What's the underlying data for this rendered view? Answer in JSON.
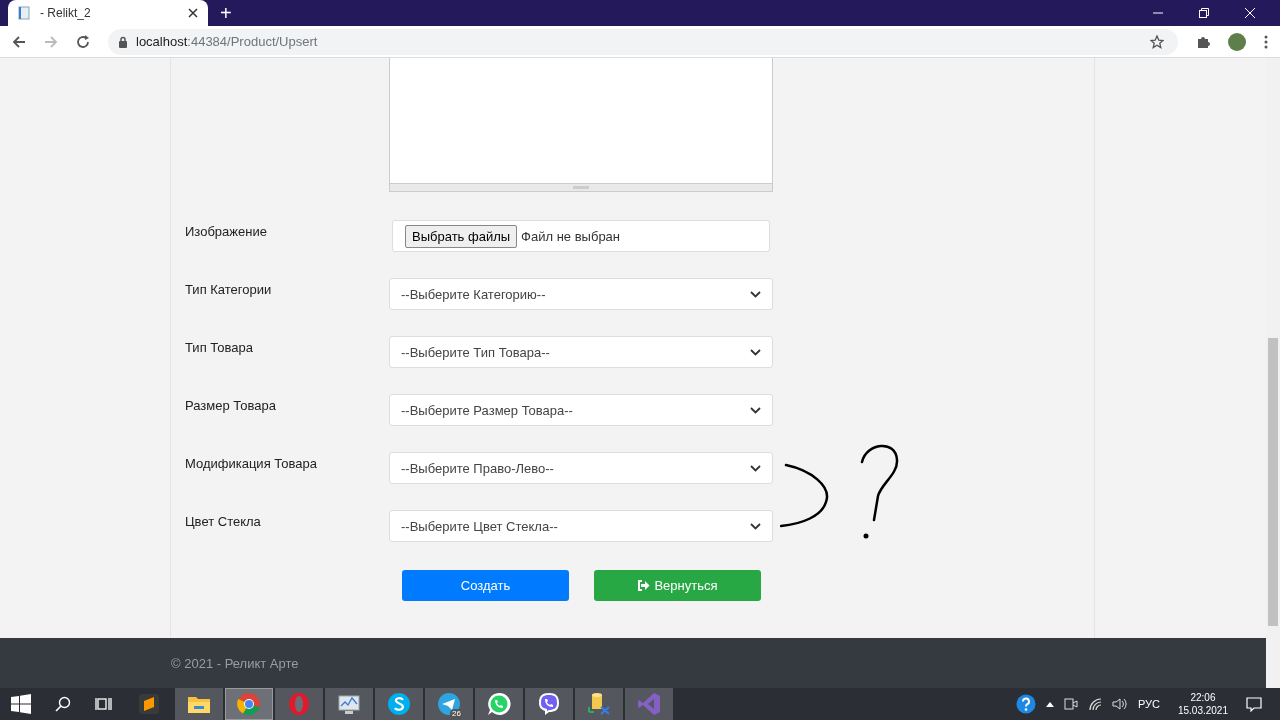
{
  "browser": {
    "tab": {
      "title": "- Relikt_2",
      "selected": true
    },
    "new_tab": "+",
    "url": {
      "host": "localhost",
      "path": ":44384/Product/Upsert"
    },
    "forward_disabled": true
  },
  "form": {
    "fields": [
      {
        "kind": "file",
        "label": "Изображение",
        "button": "Выбрать файлы",
        "status": "Файл не выбран"
      },
      {
        "kind": "select",
        "label": "Тип Категории",
        "value": "--Выберите Категорию--"
      },
      {
        "kind": "select",
        "label": "Тип Товара",
        "value": "--Выберите Тип Товара--"
      },
      {
        "kind": "select",
        "label": "Размер Товара",
        "value": "--Выберите Размер Товара--"
      },
      {
        "kind": "select",
        "label": "Модификация Товара",
        "value": "--Выберите Право-Лево--"
      },
      {
        "kind": "select",
        "label": "Цвет Стекла",
        "value": "--Выберите Цвет Стекла--"
      }
    ],
    "buttons": [
      {
        "kind": "primary",
        "label": "Создать"
      },
      {
        "kind": "back",
        "label": "Вернуться"
      }
    ]
  },
  "footer": {
    "text": "© 2021 - Реликт Арте"
  },
  "taskbar": {
    "apps": [
      {
        "kind": "sublime",
        "open": false,
        "selected": false
      },
      {
        "kind": "explorer",
        "open": true,
        "selected": false
      },
      {
        "kind": "chrome",
        "open": true,
        "selected": true
      },
      {
        "kind": "opera",
        "open": true,
        "selected": false
      },
      {
        "kind": "monitor",
        "open": true,
        "selected": false
      },
      {
        "kind": "skype",
        "open": true,
        "selected": false
      },
      {
        "kind": "telegram",
        "open": true,
        "selected": false,
        "badge": "26"
      },
      {
        "kind": "whatsapp",
        "open": true,
        "selected": false
      },
      {
        "kind": "viber",
        "open": true,
        "selected": false
      },
      {
        "kind": "database",
        "open": true,
        "selected": false
      },
      {
        "kind": "studio",
        "open": true,
        "selected": false
      }
    ],
    "tray": {
      "language": "РУС",
      "time": "22:06",
      "date": "15.03.2021"
    }
  }
}
